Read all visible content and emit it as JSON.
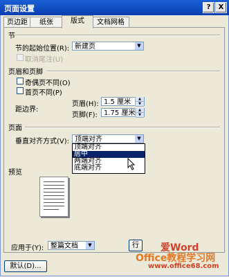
{
  "window": {
    "title": "页面设置",
    "help": "?",
    "close": "X"
  },
  "tabs": [
    {
      "label": "页边距"
    },
    {
      "label": "纸张"
    },
    {
      "label": "版式"
    },
    {
      "label": "文档网格"
    }
  ],
  "section": {
    "title": "节",
    "start_label": "节的起始位置(R):",
    "start_value": "新建页",
    "suppress_endnotes": "取消尾注(U)"
  },
  "header_footer": {
    "title": "页眉和页脚",
    "odd_even": "奇偶页不同(O)",
    "first_page": "首页不同(P)",
    "from_edge_label": "距边界:",
    "header_label": "页眉(H):",
    "header_value": "1.5 厘米",
    "footer_label": "页脚(F):",
    "footer_value": "1.75 厘米"
  },
  "page": {
    "title": "页面",
    "valign_label": "垂直对齐方式(V):",
    "valign_value": "顶端对齐",
    "options": [
      "顶端对齐",
      "居中",
      "两端对齐",
      "底端对齐"
    ],
    "selected_index": 1
  },
  "preview": {
    "title": "预览"
  },
  "apply": {
    "label": "应用于(Y):",
    "value": "整篇文档",
    "line_numbers_btn": "行"
  },
  "footer": {
    "default_btn": "默认(D)..."
  },
  "watermark": {
    "line1": "爱Word",
    "line2": "Office教程学习网",
    "line3": "www.office68.com"
  }
}
